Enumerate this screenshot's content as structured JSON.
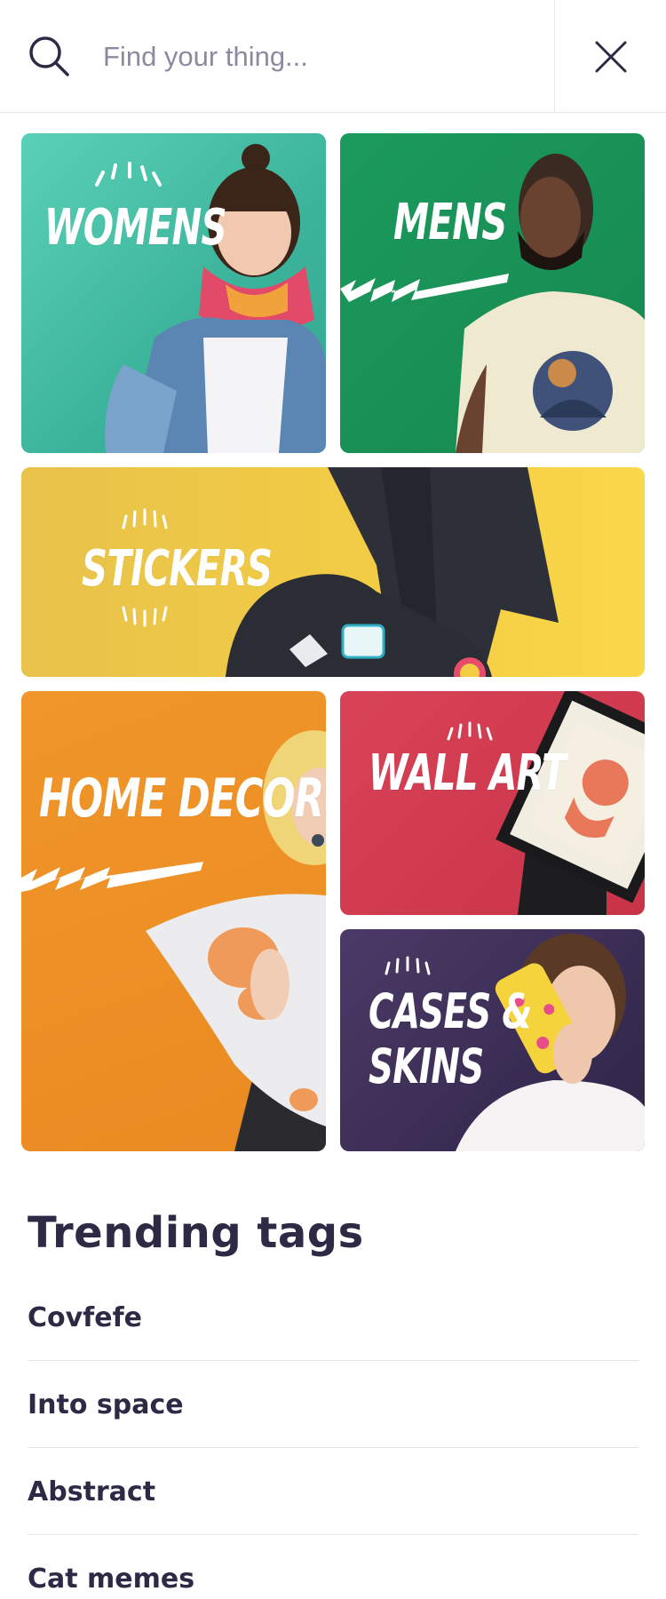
{
  "search": {
    "placeholder": "Find your thing...",
    "value": ""
  },
  "categories": [
    {
      "label": "WOMENS"
    },
    {
      "label": "MENS"
    },
    {
      "label": "STICKERS"
    },
    {
      "label": "HOME DECOR"
    },
    {
      "label": "WALL ART"
    },
    {
      "label": "CASES &",
      "label2": "SKINS"
    }
  ],
  "trending": {
    "title": "Trending tags",
    "tags": [
      "Covfefe",
      "Into space",
      "Abstract",
      "Cat memes"
    ]
  },
  "colors": {
    "womens": "#3bb39a",
    "mens": "#16884f",
    "stickers": "#f3cd44",
    "home_decor": "#ea8a22",
    "wall_art": "#c93348",
    "cases_skins": "#3b2d55",
    "text": "#2e2a45"
  }
}
